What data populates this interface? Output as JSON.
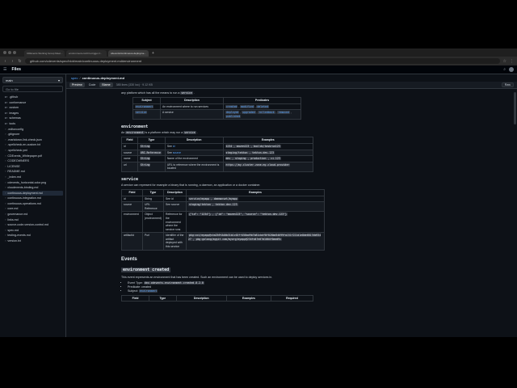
{
  "browser": {
    "tabs": [
      "CDEvents Working Group Meet...",
      "environment-confirm-trigger-f...",
      "cdevents/continuous-deployme..."
    ],
    "url": "github.com/cdevents/spec/blob/main/continuous-deployment.md#environment"
  },
  "github": {
    "title": "Files"
  },
  "sidebar": {
    "branch": "main",
    "goto_placeholder": "Go to file",
    "items": [
      {
        "label": ".github",
        "type": "folder"
      },
      {
        "label": "conformance",
        "type": "folder"
      },
      {
        "label": "custom",
        "type": "folder"
      },
      {
        "label": "images",
        "type": "folder"
      },
      {
        "label": "schemas",
        "type": "folder"
      },
      {
        "label": "tools",
        "type": "folder"
      },
      {
        "label": ".editorconfig",
        "type": "file"
      },
      {
        "label": ".gitignore",
        "type": "file"
      },
      {
        "label": ".markdown-link-check.json",
        "type": "file"
      },
      {
        "label": ".spellcheck-en-custom.txt",
        "type": "file"
      },
      {
        "label": ".spellcheck.yml",
        "type": "file"
      },
      {
        "label": "CDEvents_Whitepaper.pdf",
        "type": "file"
      },
      {
        "label": "CODEOWNERS",
        "type": "file"
      },
      {
        "label": "LICENSE",
        "type": "file"
      },
      {
        "label": "README.md",
        "type": "file"
      },
      {
        "label": "_index.md",
        "type": "file"
      },
      {
        "label": "cdevents_horizontal-color.png",
        "type": "file"
      },
      {
        "label": "cloudevents-binding.md",
        "type": "file"
      },
      {
        "label": "continuous-deployment.md",
        "type": "file",
        "active": true
      },
      {
        "label": "continuous-integration.md",
        "type": "file"
      },
      {
        "label": "continuous-operations.md",
        "type": "file"
      },
      {
        "label": "core.md",
        "type": "file"
      },
      {
        "label": "governance.md",
        "type": "file"
      },
      {
        "label": "links.md",
        "type": "file"
      },
      {
        "label": "source-code-version-control.md",
        "type": "file"
      },
      {
        "label": "spec.md",
        "type": "file"
      },
      {
        "label": "testing-events.md",
        "type": "file"
      },
      {
        "label": "version.txt",
        "type": "file"
      }
    ]
  },
  "breadcrumb": {
    "repo": "spec",
    "file": "continuous-deployment.md"
  },
  "filebar": {
    "preview": "Preview",
    "code": "Code",
    "blame": "Blame",
    "meta": "385 lines (330 loc) · 9.12 KB",
    "raw": "Raw"
  },
  "doc": {
    "intro": "any platform which has all the means to run a",
    "intro_code": "service",
    "subjects_table": {
      "headers": [
        "Subject",
        "Description",
        "Predicates"
      ],
      "rows": [
        {
          "subject": "environment",
          "description": "An environment where to run services",
          "predicates": [
            "created",
            "modified",
            "deleted"
          ]
        },
        {
          "subject": "service",
          "description": "A service",
          "predicates": [
            "deployed",
            "upgraded",
            "rolledback",
            "removed",
            "published"
          ]
        }
      ]
    },
    "env_heading": "environment",
    "env_text_a": "An",
    "env_text_code": "environment",
    "env_text_b": "is a platform which may run a",
    "env_text_code2": "service",
    "env_table": {
      "headers": [
        "Field",
        "Type",
        "Description",
        "Examples"
      ],
      "rows": [
        {
          "field": "id",
          "type": "String",
          "desc_pre": "See",
          "desc_link": "id",
          "example": "1234 , maven123 , builds/taskrun123"
        },
        {
          "field": "source",
          "type": "URI-Reference",
          "desc_pre": "See",
          "desc_link": "source",
          "example": "staging/tekton , tekton-dev-123"
        },
        {
          "field": "name",
          "type": "String",
          "desc_pre": "Name of the environment",
          "desc_link": "",
          "example": "dev , staging , production , ci-123"
        },
        {
          "field": "url",
          "type": "String",
          "desc_pre": "URL to reference where the environment is located",
          "desc_link": "",
          "example": "https://my-cluster.zone.my-cloud-provider"
        }
      ]
    },
    "svc_heading": "service",
    "svc_text": "A service can represent for example a binary that is running, a daemon, an application or a docker container.",
    "svc_table": {
      "headers": [
        "Field",
        "Type",
        "Description",
        "Examples"
      ],
      "rows": [
        {
          "field": "id",
          "type": "String",
          "desc": "See id",
          "example": "service/myapp , daemonset/myapp"
        },
        {
          "field": "source",
          "type": "URI-Reference",
          "desc": "See source",
          "example": "staging/tekton , tekton-dev-123"
        },
        {
          "field": "environment",
          "type": "Object (environment)",
          "desc": "Reference for the environment where the service runs",
          "example": "{\"id\": \"1234\"} , {\"id\": \"maven123\", \"source\": \"tekton-dev-123\"}"
        },
        {
          "field": "artifactId",
          "type": "Purl",
          "desc": "Identifier of the artifact deployed with this service",
          "example": "pkg:oci/myapp@sha256%3A0b31b1c02ff458ad9b7b81cbdf8f028bd54699fa151f221d1e8de6817db93427 , pkg:golang/mygit.com/myorg/myapp@234fd47e07d1004f0aed9c"
        }
      ]
    },
    "events_heading": "Events",
    "env_created_heading": "environment created",
    "env_created_text": "This event represents an environment that has been created. Such an environment can be used to deploy services in.",
    "bullets": {
      "event_type_label": "Event Type:",
      "event_type": "dev.cdevents.environment.created.0.2.0",
      "predicate_label": "Predicate: created",
      "subject_label": "Subject:",
      "subject_link": "environment"
    },
    "last_table_headers": [
      "Field",
      "Type",
      "Description",
      "Examples",
      "Required"
    ]
  }
}
